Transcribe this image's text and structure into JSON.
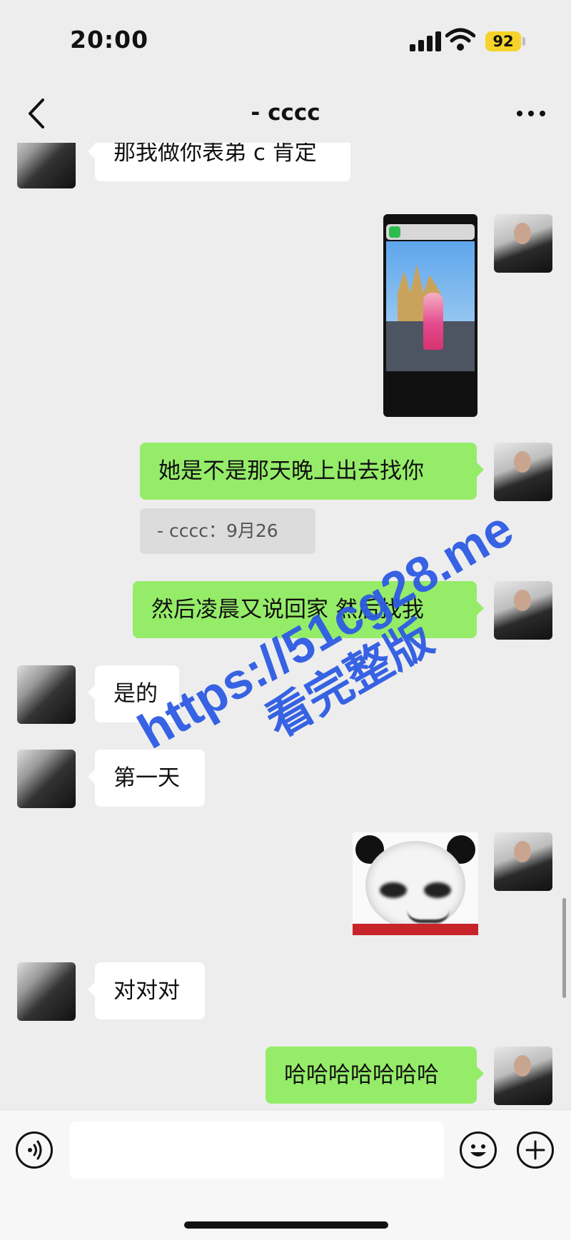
{
  "status_bar": {
    "time": "20:00",
    "battery": "92"
  },
  "header": {
    "title": "- cccc"
  },
  "messages": [
    {
      "from": "them",
      "type": "text",
      "text": "那我做你表弟 c 肯定"
    },
    {
      "from": "me",
      "type": "image",
      "icon": "screenshot-image"
    },
    {
      "from": "me",
      "type": "text",
      "text": "她是不是那天晚上出去找你"
    },
    {
      "from": "me",
      "type": "quote",
      "text": "- cccc：9月26"
    },
    {
      "from": "me",
      "type": "text",
      "text": "然后凌晨又说回家 然后找我"
    },
    {
      "from": "them",
      "type": "text",
      "text": "是的"
    },
    {
      "from": "them",
      "type": "text",
      "text": "第一天"
    },
    {
      "from": "me",
      "type": "sticker",
      "icon": "panda-sticker"
    },
    {
      "from": "them",
      "type": "text",
      "text": "对对对"
    },
    {
      "from": "me",
      "type": "text",
      "text": "哈哈哈哈哈哈哈"
    }
  ],
  "input_bar": {
    "placeholder": "",
    "voice_icon": "voice-icon",
    "emoji_icon": "emoji-icon",
    "plus_icon": "plus-icon"
  },
  "watermark": {
    "line1": "https://51cg28.me",
    "line2": "看完整版"
  },
  "colors": {
    "background": "#ededed",
    "my_bubble": "#95ec69",
    "their_bubble": "#ffffff",
    "watermark": "#2d5be3"
  }
}
